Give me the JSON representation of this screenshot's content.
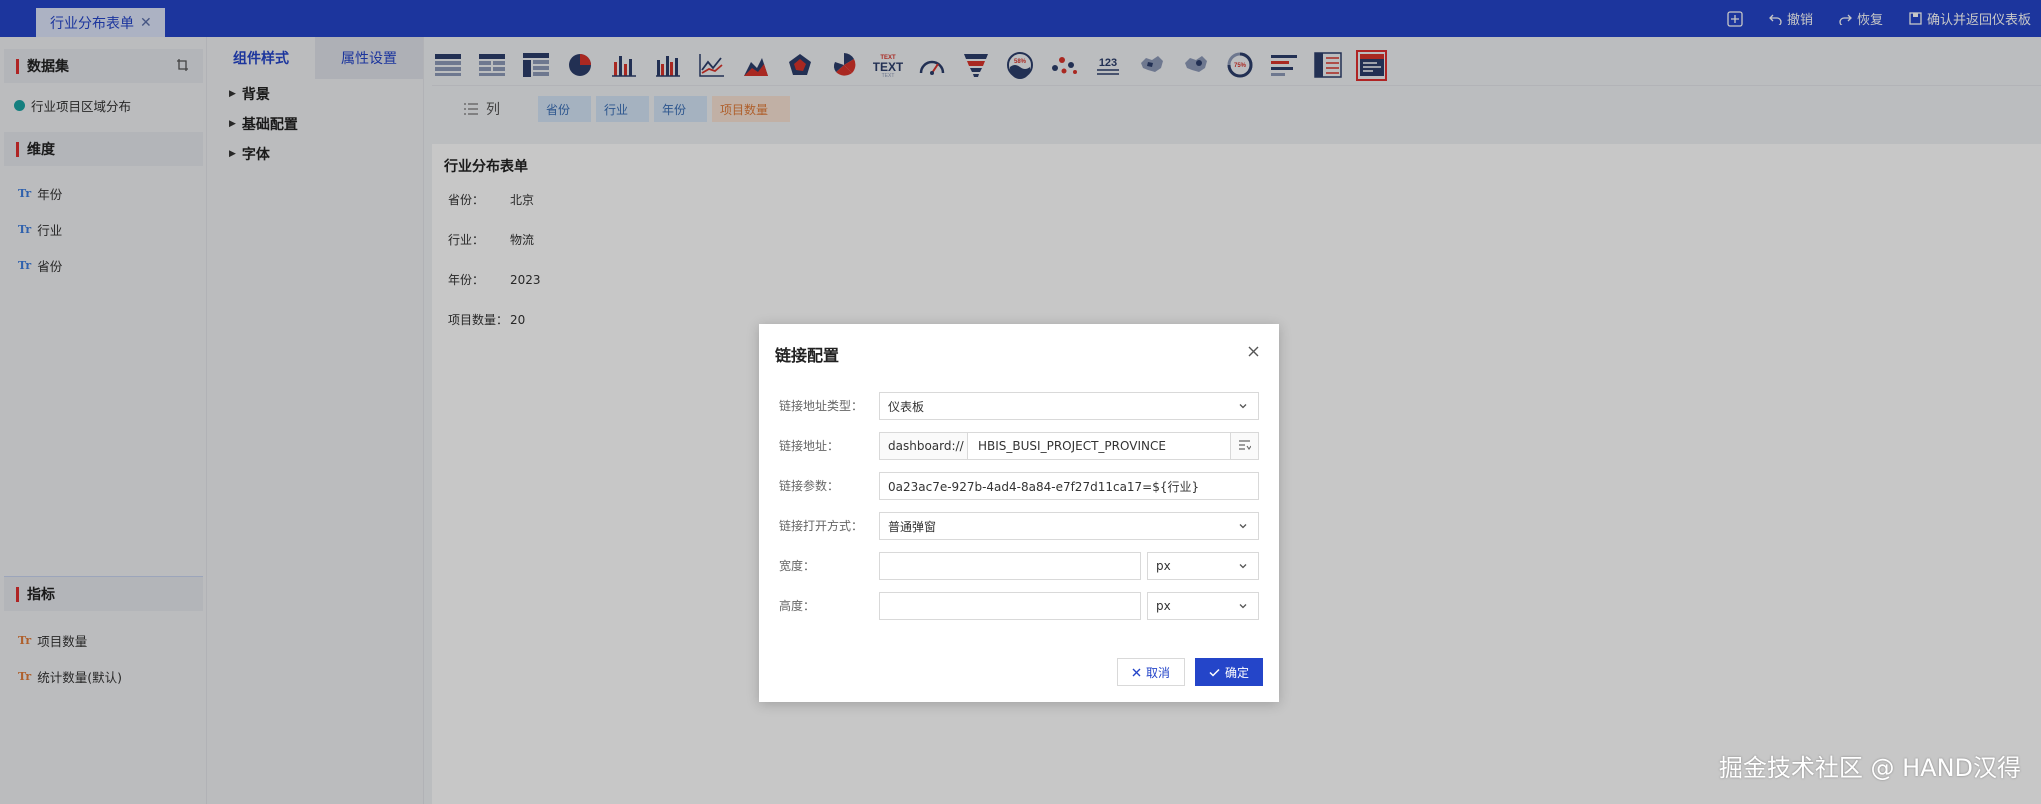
{
  "tab": {
    "title": "行业分布表单"
  },
  "top_actions": {
    "undo": "撤销",
    "redo": "恢复",
    "confirm": "确认并返回仪表板"
  },
  "left_panel": {
    "dataset_header": "数据集",
    "dataset_item": "行业项目区域分布",
    "dimension_header": "维度",
    "dimensions": [
      "年份",
      "行业",
      "省份"
    ],
    "measure_header": "指标",
    "measures": [
      "项目数量",
      "统计数量(默认)"
    ]
  },
  "style_panel": {
    "tabs": [
      "组件样式",
      "属性设置"
    ],
    "tree": [
      "背景",
      "基础配置",
      "字体"
    ]
  },
  "chart_toolbar": {
    "icons": [
      "table-1",
      "table-2",
      "table-3",
      "pie",
      "bar",
      "bar-2",
      "line",
      "area",
      "radar",
      "rose",
      "text",
      "gauge",
      "funnel",
      "water-ball",
      "scatter",
      "number",
      "map",
      "map-2",
      "ring-progress",
      "progress-bar",
      "pivot-table",
      "form-card"
    ],
    "text_icon_label": "TEXT",
    "water_ball_label": "58%",
    "number_icon_label": "123",
    "ring_label": "75%"
  },
  "column_row": {
    "label": "列",
    "chips": [
      "省份",
      "行业",
      "年份",
      "项目数量"
    ]
  },
  "canvas": {
    "title": "行业分布表单",
    "rows": [
      {
        "key": "省份：",
        "value": "北京"
      },
      {
        "key": "行业：",
        "value": "物流"
      },
      {
        "key": "年份：",
        "value": "2023"
      },
      {
        "key": "项目数量：",
        "value": "20"
      }
    ]
  },
  "modal": {
    "title": "链接配置",
    "link_type_label": "链接地址类型：",
    "link_type_value": "仪表板",
    "link_addr_label": "链接地址：",
    "link_addr_prefix": "dashboard://",
    "link_addr_value": "HBIS_BUSI_PROJECT_PROVINCE",
    "link_param_label": "链接参数：",
    "link_param_value": "0a23ac7e-927b-4ad4-8a84-e7f27d11ca17=${行业}",
    "open_mode_label": "链接打开方式：",
    "open_mode_value": "普通弹窗",
    "width_label": "宽度：",
    "width_value": "",
    "width_unit": "px",
    "height_label": "高度：",
    "height_value": "",
    "height_unit": "px",
    "cancel": "取消",
    "ok": "确定"
  },
  "watermark": "掘金技术社区 @ HAND汉得",
  "colors": {
    "primary": "#2445c9",
    "accent": "#e02f2f",
    "chip_blue": "#d4e4f7",
    "chip_orange": "#f8e2d4"
  }
}
